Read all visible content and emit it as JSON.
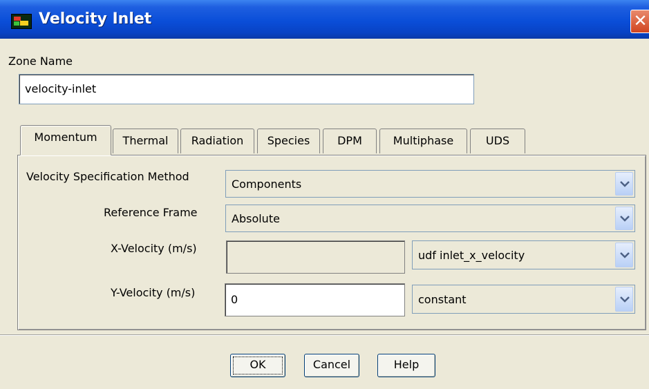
{
  "window": {
    "title": "Velocity Inlet",
    "close_glyph": "✕",
    "icon": "fluent-app-icon"
  },
  "zone": {
    "label": "Zone Name",
    "value": "velocity-inlet"
  },
  "tabs": [
    {
      "label": "Momentum",
      "active": true
    },
    {
      "label": "Thermal",
      "active": false
    },
    {
      "label": "Radiation",
      "active": false
    },
    {
      "label": "Species",
      "active": false
    },
    {
      "label": "DPM",
      "active": false
    },
    {
      "label": "Multiphase",
      "active": false
    },
    {
      "label": "UDS",
      "active": false
    }
  ],
  "momentum": {
    "velocity_spec": {
      "label": "Velocity Specification Method",
      "value": "Components"
    },
    "reference_frame": {
      "label": "Reference Frame",
      "value": "Absolute"
    },
    "x_velocity": {
      "label": "X-Velocity (m/s)",
      "value": "",
      "profile": "udf inlet_x_velocity"
    },
    "y_velocity": {
      "label": "Y-Velocity (m/s)",
      "value": "0",
      "profile": "constant"
    }
  },
  "buttons": {
    "ok": "OK",
    "cancel": "Cancel",
    "help": "Help"
  },
  "colors": {
    "titlebar": "#0a4ed8",
    "dialog_bg": "#ece9d8",
    "close_button": "#d1441f"
  }
}
